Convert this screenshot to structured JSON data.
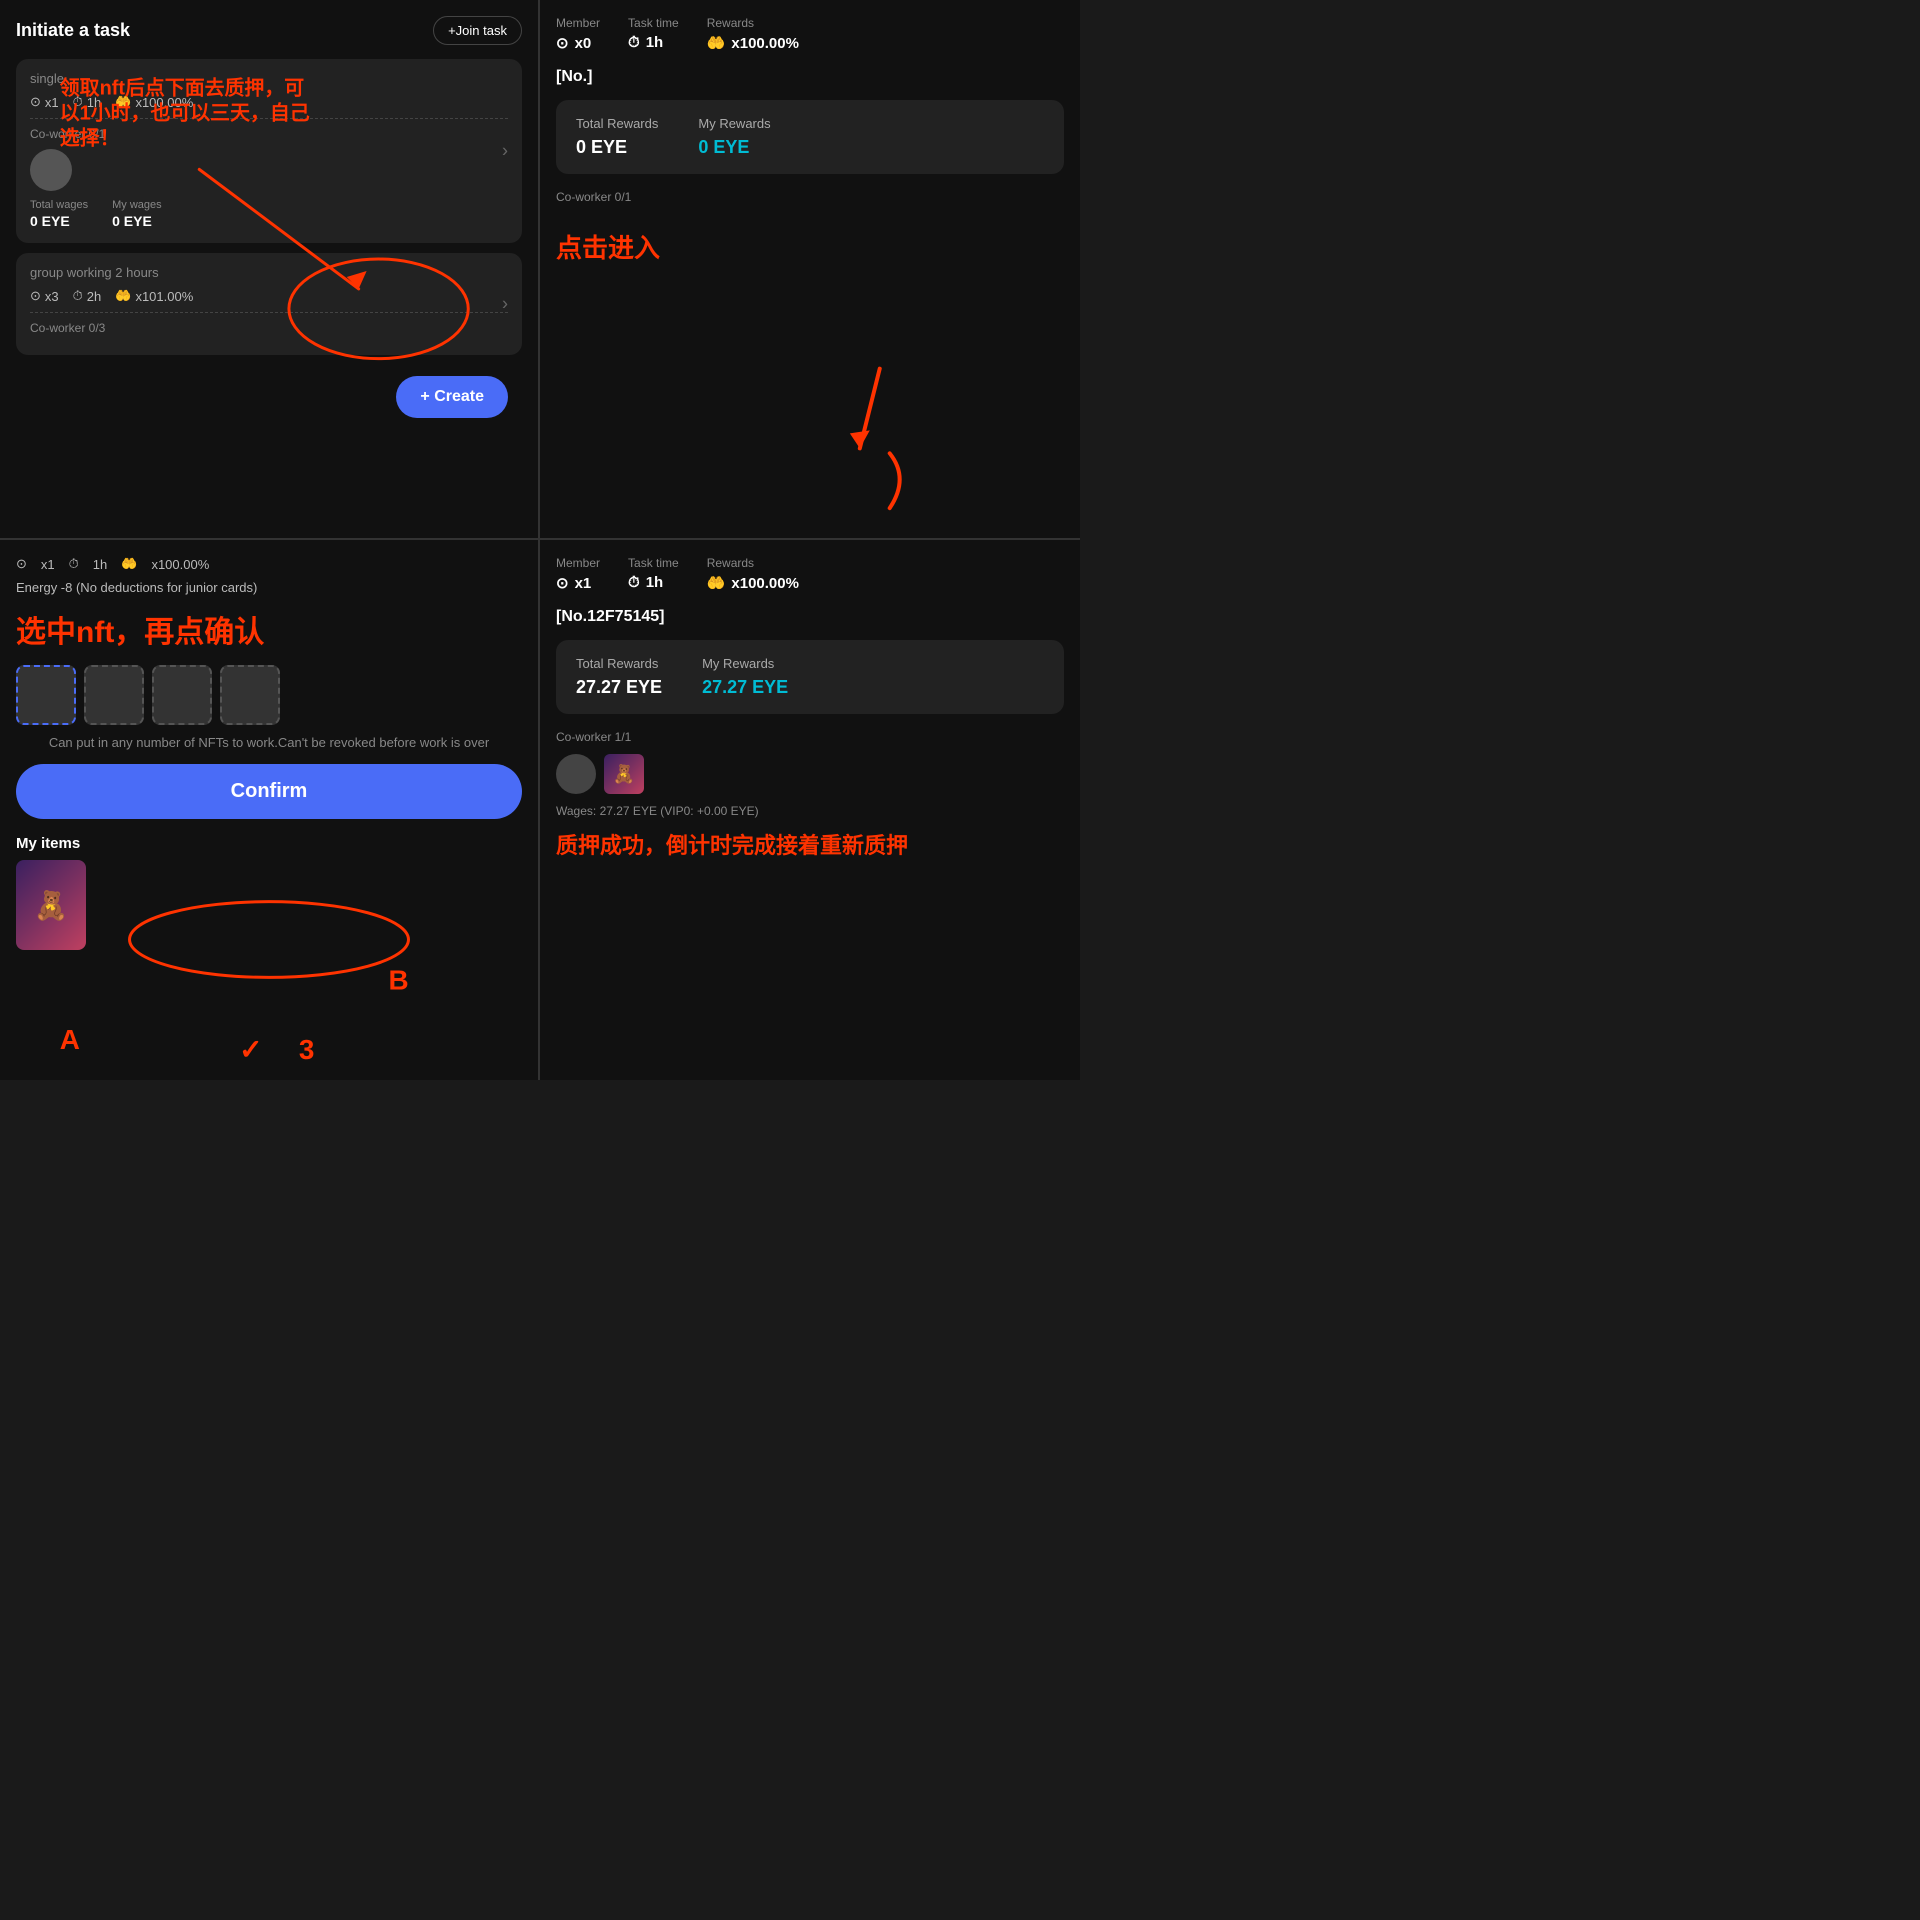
{
  "topLeft": {
    "title": "Initiate a task",
    "joinBtn": "+Join task",
    "card1": {
      "title": "single",
      "meta": [
        "x1",
        "1h",
        "x100.00%"
      ],
      "coworkerLabel": "Co-worker 0/1",
      "totalWagesLabel": "Total wages",
      "totalWagesValue": "0 EYE",
      "myWagesLabel": "My wages",
      "myWagesValue": "0 EYE"
    },
    "card2": {
      "title": "group working 2 hours",
      "meta": [
        "x3",
        "2h",
        "x101.00%"
      ],
      "coworkerLabel": "Co-worker 0/3"
    },
    "createBtn": "+ Create",
    "annotation": "领取nft后点下面去质押，可以1小时，也可以三天，自己选择！"
  },
  "topRight": {
    "memberLabel": "Member",
    "memberValue": "x0",
    "taskTimeLabel": "Task time",
    "taskTimeValue": "1h",
    "rewardsLabel": "Rewards",
    "rewardsValue": "x100.00%",
    "taskId": "[No.]",
    "totalRewardsLabel": "Total Rewards",
    "totalRewardsValue": "0 EYE",
    "myRewardsLabel": "My Rewards",
    "myRewardsValue": "0 EYE",
    "coworkerLabel": "Co-worker 0/1",
    "annotation": "点击进入"
  },
  "bottomLeft": {
    "meta": [
      "x1",
      "1h",
      "x100.00%"
    ],
    "energyText": "Energy -8 (No deductions for junior cards)",
    "annotation1": "选中nft，再点确认",
    "cantRevokeText": "Can put in any number of NFTs to work.Can't be revoked before work is over",
    "confirmBtn": "Confirm",
    "myItemsLabel": "My items",
    "annotation2": "A",
    "annotation3": "B",
    "annotation4": "3"
  },
  "bottomRight": {
    "memberLabel": "Member",
    "memberValue": "x1",
    "taskTimeLabel": "Task time",
    "taskTimeValue": "1h",
    "rewardsLabel": "Rewards",
    "rewardsValue": "x100.00%",
    "taskId": "[No.12F75145]",
    "totalRewardsLabel": "Total Rewards",
    "totalRewardsValue": "27.27 EYE",
    "myRewardsLabel": "My Rewards",
    "myRewardsValue": "27.27 EYE",
    "coworkerLabel": "Co-worker 1/1",
    "wagesText": "Wages: 27.27 EYE (VIP0: +0.00 EYE)",
    "annotation": "质押成功，倒计时完成接着重新质押"
  },
  "icons": {
    "person": "⊙",
    "clock": "⏱",
    "hand": "🤲",
    "chevron": "›"
  }
}
